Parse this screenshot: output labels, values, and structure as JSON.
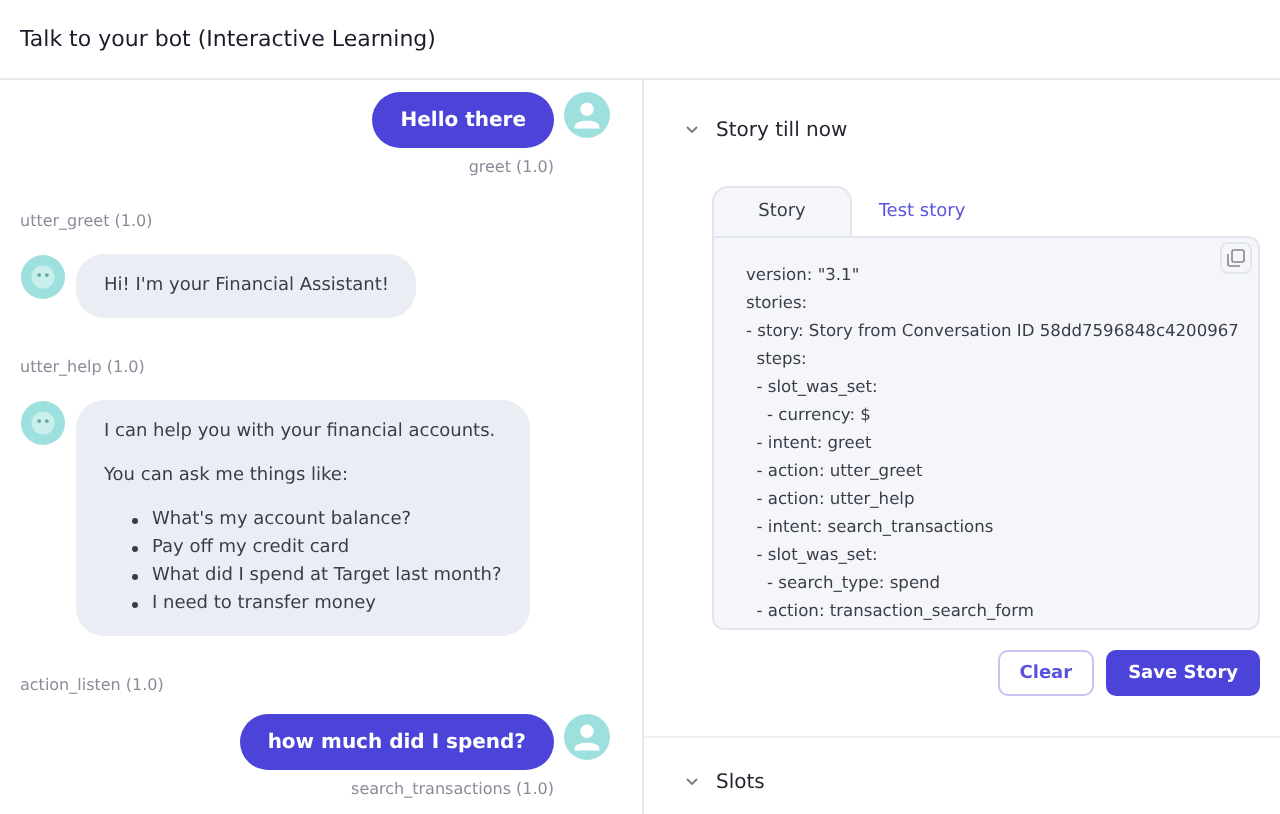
{
  "header": {
    "title": "Talk to your bot (Interactive Learning)"
  },
  "conversation": [
    {
      "kind": "user",
      "text": "Hello there",
      "label": "greet (1.0)"
    },
    {
      "kind": "bot",
      "label": "utter_greet (1.0)",
      "paragraphs": [
        "Hi! I'm your Financial Assistant!"
      ]
    },
    {
      "kind": "bot",
      "label": "utter_help (1.0)",
      "paragraphs": [
        "I can help you with your financial accounts.",
        "You can ask me things like:"
      ],
      "bullets": [
        "What's my account balance?",
        "Pay off my credit card",
        "What did I spend at Target last month?",
        "I need to transfer money"
      ]
    },
    {
      "kind": "action",
      "label": "action_listen (1.0)"
    },
    {
      "kind": "user",
      "text": "how much did I spend?",
      "label": "search_transactions (1.0)"
    }
  ],
  "story_panel": {
    "title": "Story till now",
    "tabs": [
      {
        "label": "Story",
        "selected": true
      },
      {
        "label": "Test story",
        "selected": false
      }
    ],
    "code_lines": [
      "version: \"3.1\"",
      "stories:",
      "- story: Story from Conversation ID 58dd7596848c4200967",
      "  steps:",
      "  - slot_was_set:",
      "    - currency: $",
      "  - intent: greet",
      "  - action: utter_greet",
      "  - action: utter_help",
      "  - intent: search_transactions",
      "  - slot_was_set:",
      "    - search_type: spend",
      "  - action: transaction_search_form"
    ],
    "buttons": [
      {
        "label": "Clear",
        "kind": "secondary"
      },
      {
        "label": "Save Story",
        "kind": "primary"
      }
    ]
  },
  "slots_panel": {
    "title": "Slots"
  }
}
